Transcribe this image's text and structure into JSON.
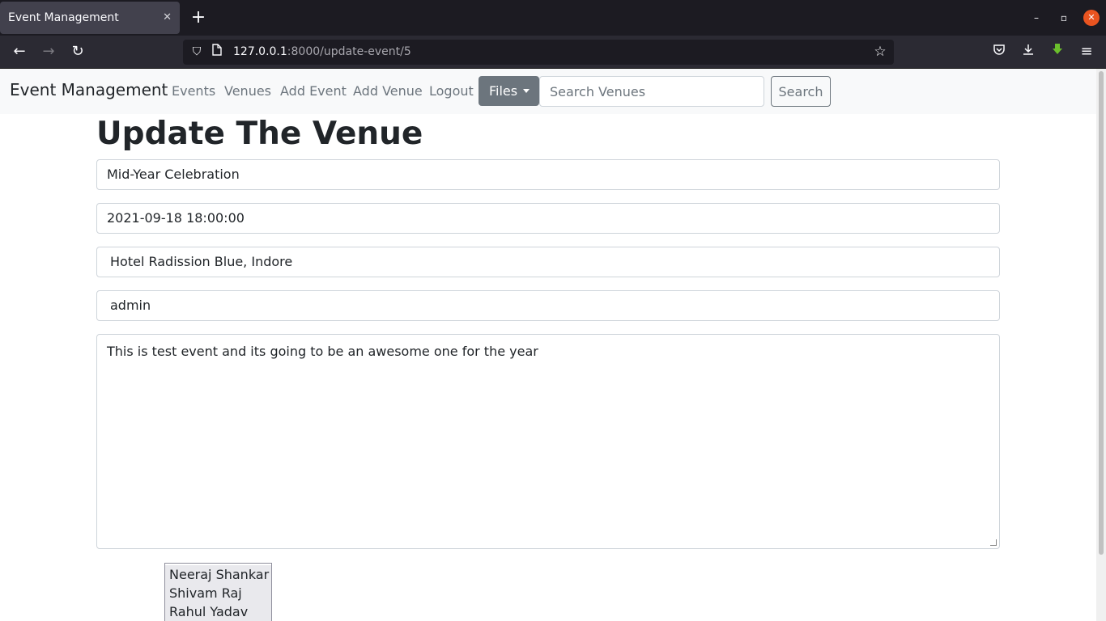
{
  "browser": {
    "tab_title": "Event Management",
    "tab_close": "✕",
    "new_tab": "+",
    "url_host": "127.0.0.1",
    "url_rest": ":8000/update-event/5",
    "window_controls": {
      "minimize": "–",
      "maximize": "▫",
      "close": "✕"
    }
  },
  "site_nav": {
    "brand": "Event Management",
    "links": [
      "Events",
      "Venues",
      "Add Event",
      "Add Venue",
      "Logout"
    ],
    "files_label": "Files",
    "search_placeholder": "Search Venues",
    "search_button": "Search"
  },
  "page": {
    "title": "Update The Venue",
    "event_name": "Mid-Year Celebration",
    "event_date": "2021-09-18 18:00:00",
    "venue": "Hotel Radission Blue, Indore",
    "manager": "admin",
    "description": "This is  test event and its going to be an awesome one for the year",
    "attendees": [
      "Neeraj Shankar",
      "Shivam Raj",
      "Rahul Yadav"
    ]
  }
}
